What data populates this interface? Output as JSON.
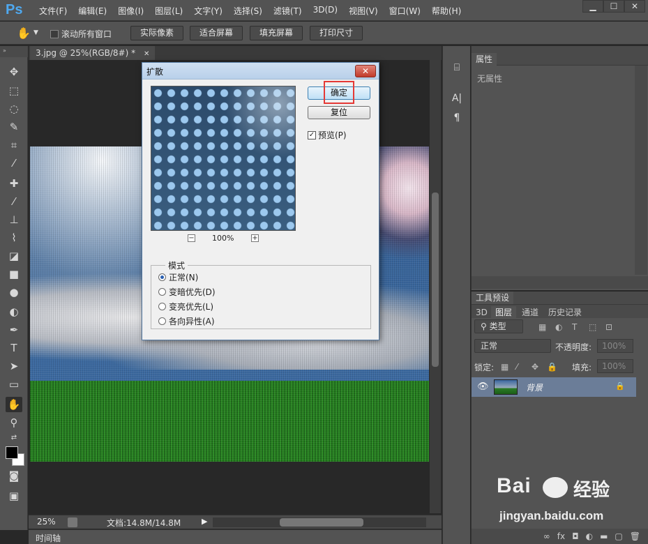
{
  "app": {
    "logo": "Ps",
    "menu": [
      "文件(F)",
      "编辑(E)",
      "图像(I)",
      "图层(L)",
      "文字(Y)",
      "选择(S)",
      "滤镜(T)",
      "3D(D)",
      "视图(V)",
      "窗口(W)",
      "帮助(H)"
    ],
    "window_controls": [
      "▁",
      "☐",
      "✕"
    ]
  },
  "options": {
    "scroll_all_label": "滚动所有窗口",
    "buttons": [
      "实际像素",
      "适合屏幕",
      "填充屏幕",
      "打印尺寸"
    ]
  },
  "document": {
    "tab_title": "3.jpg @ 25%(RGB/8#) *",
    "tab_close": "✕",
    "zoom": "25%",
    "doc_size": "文档:14.8M/14.8M",
    "timeline_label": "时间轴"
  },
  "dialog": {
    "title": "扩散",
    "close": "✕",
    "ok_label": "确定",
    "reset_label": "复位",
    "preview_label": "预览(P)",
    "preview_checked": true,
    "zoom_level": "100%",
    "zoom_out": "−",
    "zoom_in": "+",
    "mode_legend": "模式",
    "modes": [
      "正常(N)",
      "变暗优先(D)",
      "变亮优先(L)",
      "各向异性(A)"
    ],
    "selected_mode": "正常(N)"
  },
  "properties": {
    "tab": "属性",
    "empty_text": "无属性"
  },
  "layers": {
    "preset_tab": "工具预设",
    "tabs": [
      "3D",
      "图层",
      "通道",
      "历史记录"
    ],
    "active_tab": "图层",
    "filter_type": "类型",
    "blend_mode": "正常",
    "opacity_label": "不透明度:",
    "opacity_value": "100%",
    "lock_label": "锁定:",
    "fill_label": "填充:",
    "fill_value": "100%",
    "layer_name": "背景"
  },
  "watermark": {
    "brand": "Bai",
    "brand_suffix": "经验",
    "url": "jingyan.baidu.com"
  }
}
